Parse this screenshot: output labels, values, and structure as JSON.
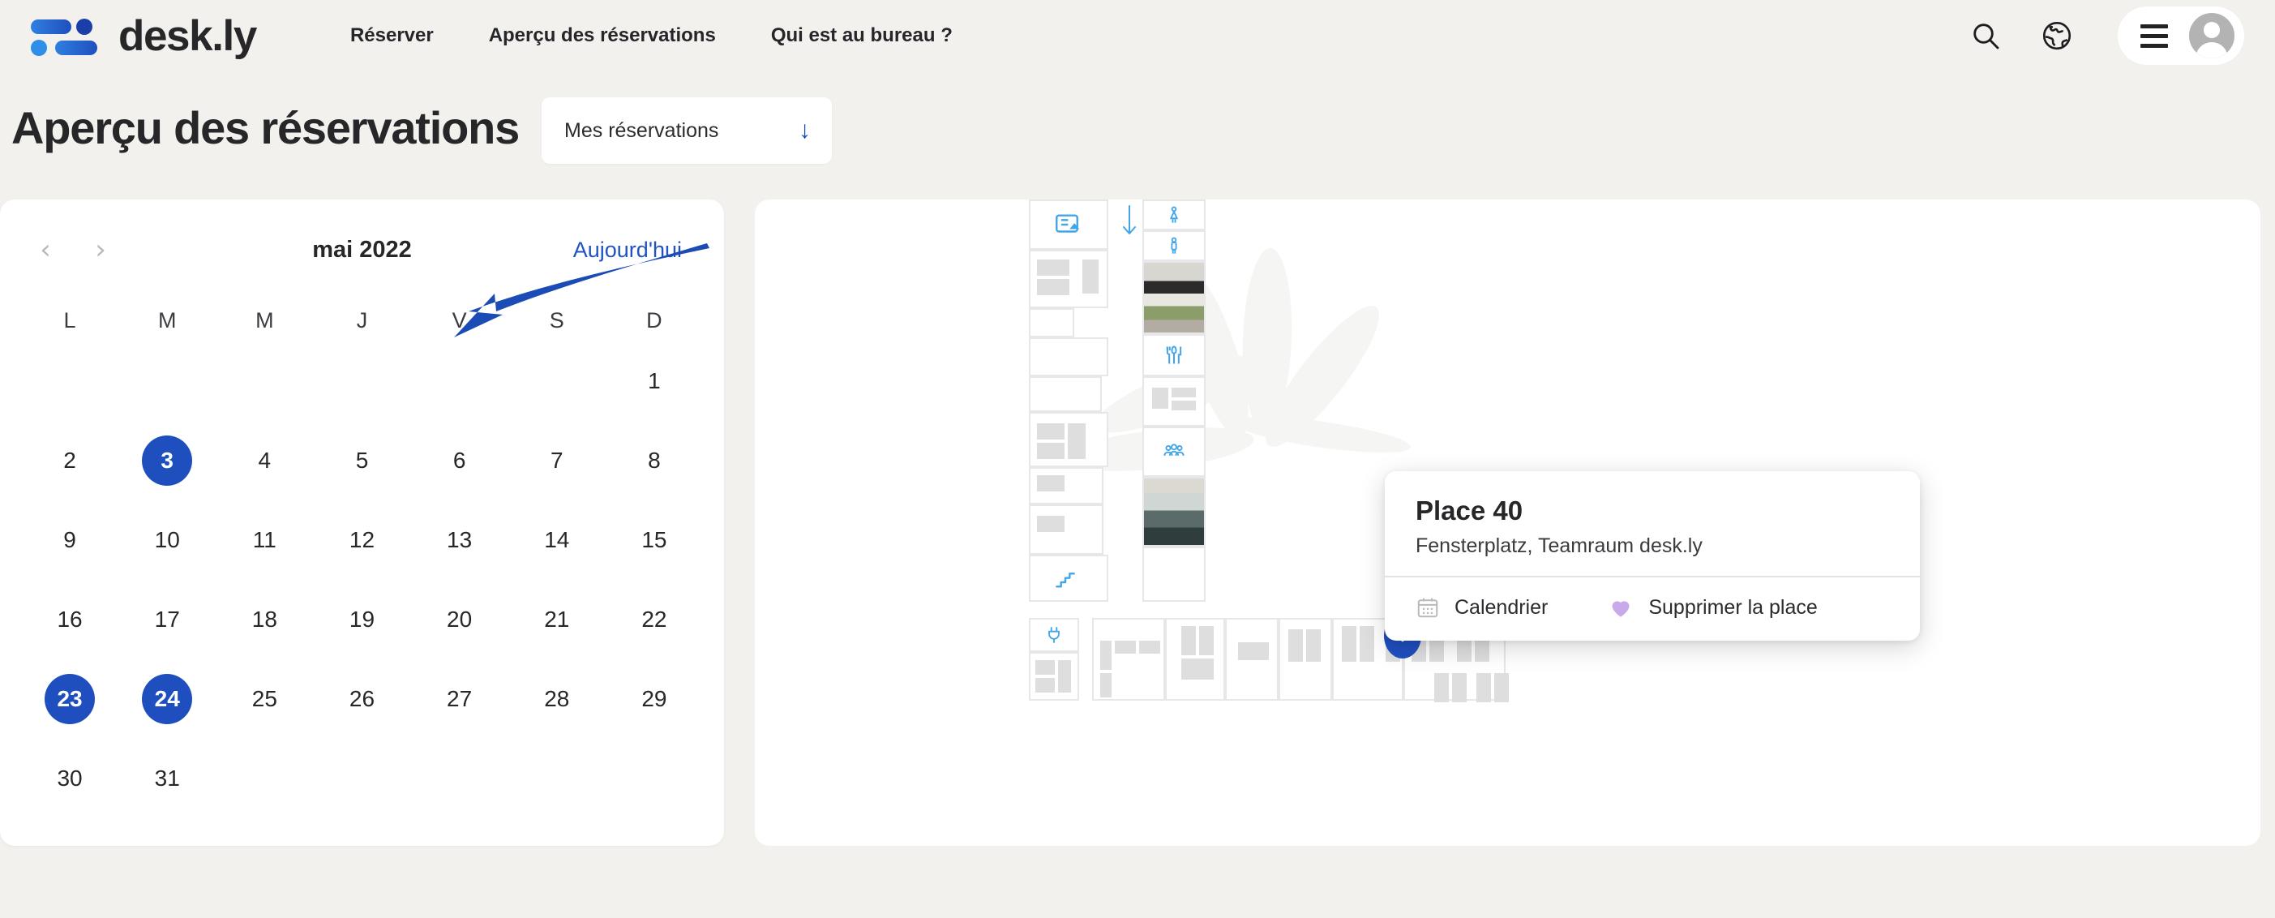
{
  "brand": {
    "name": "desk.ly",
    "logo_icon": "desk-ly-logo-icon"
  },
  "nav": {
    "links": [
      {
        "label": "Réserver",
        "name": "nav-reserver"
      },
      {
        "label": "Aperçu des réservations",
        "name": "nav-apercu-reservations"
      },
      {
        "label": "Qui est au bureau ?",
        "name": "nav-qui-est-au-bureau"
      }
    ],
    "search_icon": "search-icon",
    "language_icon": "globe-icon",
    "menu_icon": "hamburger-menu-icon",
    "avatar_icon": "user-avatar-icon"
  },
  "page": {
    "title": "Aperçu des réservations",
    "filter": {
      "value": "Mes réservations",
      "arrow_icon": "arrow-down-icon"
    }
  },
  "calendar": {
    "month_label": "mai 2022",
    "prev_icon": "chevron-left-icon",
    "next_icon": "chevron-right-icon",
    "today_label": "Aujourd'hui",
    "weekdays": [
      "L",
      "M",
      "M",
      "J",
      "V",
      "S",
      "D"
    ],
    "lead_blanks": 6,
    "days": [
      1,
      2,
      3,
      4,
      5,
      6,
      7,
      8,
      9,
      10,
      11,
      12,
      13,
      14,
      15,
      16,
      17,
      18,
      19,
      20,
      21,
      22,
      23,
      24,
      25,
      26,
      27,
      28,
      29,
      30,
      31
    ],
    "selected_days": [
      3,
      23,
      24
    ],
    "accent_color": "#1f4fbf"
  },
  "floorplan": {
    "pin_icon": "heart-pin-icon",
    "room_icons": [
      "printer-icon",
      "arrow-down-icon",
      "restroom-women-icon",
      "restroom-men-icon",
      "cutlery-icon",
      "people-group-icon",
      "stairs-icon",
      "power-plug-icon"
    ],
    "icon_color": "#42a5e8",
    "desk_color": "#dededf",
    "wall_color": "#e7e7e9"
  },
  "popup": {
    "title": "Place 40",
    "subtitle": "Fensterplatz, Teamraum desk.ly",
    "actions": [
      {
        "label": "Calendrier",
        "icon": "calendar-icon"
      },
      {
        "label": "Supprimer la place",
        "icon": "heart-icon",
        "color": "#c9a9ea"
      }
    ]
  },
  "annotation": {
    "arrow_icon": "annotation-arrow-icon",
    "color": "#1b4bb5"
  }
}
